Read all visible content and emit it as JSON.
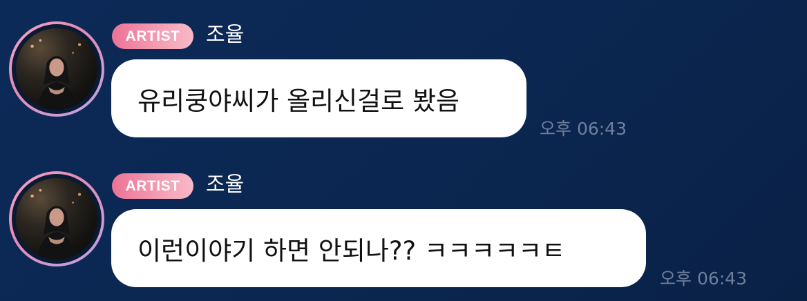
{
  "messages": [
    {
      "badge": "ARTIST",
      "sender": "조율",
      "text": "유리쿵야씨가 올리신걸로 봤음",
      "time": "오후 06:43"
    },
    {
      "badge": "ARTIST",
      "sender": "조율",
      "text": "이런이야기 하면 안되나?? ㅋㅋㅋㅋㅋㅌ",
      "time": "오후 06:43"
    }
  ],
  "colors": {
    "background": "#0b2752",
    "badge": "#ec7396",
    "bubble": "#ffffff",
    "timestamp": "#6f7f9d",
    "avatar_ring": "#e58bb5"
  },
  "icons": {
    "avatar": "profile-photo"
  }
}
